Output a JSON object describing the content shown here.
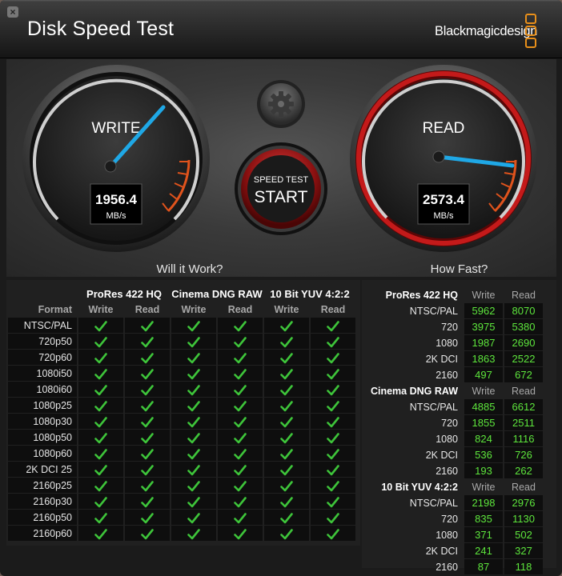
{
  "window": {
    "title": "Disk Speed Test",
    "brand": "Blackmagicdesign",
    "close_glyph": "×"
  },
  "gauges": {
    "write": {
      "label": "WRITE",
      "value": "1956.4",
      "unit": "MB/s"
    },
    "read": {
      "label": "READ",
      "value": "2573.4",
      "unit": "MB/s"
    }
  },
  "start_button": {
    "line1": "SPEED TEST",
    "line2": "START"
  },
  "settings_icon": "gear-icon",
  "will_it_work": {
    "title": "Will it Work?",
    "format_header": "Format",
    "groups": [
      "ProRes 422 HQ",
      "Cinema DNG RAW",
      "10 Bit YUV 4:2:2"
    ],
    "write_label": "Write",
    "read_label": "Read",
    "formats": [
      "NTSC/PAL",
      "720p50",
      "720p60",
      "1080i50",
      "1080i60",
      "1080p25",
      "1080p30",
      "1080p50",
      "1080p60",
      "2K DCI 25",
      "2160p25",
      "2160p30",
      "2160p50",
      "2160p60"
    ]
  },
  "how_fast": {
    "title": "How Fast?",
    "write_label": "Write",
    "read_label": "Read",
    "groups": [
      {
        "name": "ProRes 422 HQ",
        "rows": [
          {
            "format": "NTSC/PAL",
            "write": "5962",
            "read": "8070"
          },
          {
            "format": "720",
            "write": "3975",
            "read": "5380"
          },
          {
            "format": "1080",
            "write": "1987",
            "read": "2690"
          },
          {
            "format": "2K DCI",
            "write": "1863",
            "read": "2522"
          },
          {
            "format": "2160",
            "write": "497",
            "read": "672"
          }
        ]
      },
      {
        "name": "Cinema DNG RAW",
        "rows": [
          {
            "format": "NTSC/PAL",
            "write": "4885",
            "read": "6612"
          },
          {
            "format": "720",
            "write": "1855",
            "read": "2511"
          },
          {
            "format": "1080",
            "write": "824",
            "read": "1116"
          },
          {
            "format": "2K DCI",
            "write": "536",
            "read": "726"
          },
          {
            "format": "2160",
            "write": "193",
            "read": "262"
          }
        ]
      },
      {
        "name": "10 Bit YUV 4:2:2",
        "rows": [
          {
            "format": "NTSC/PAL",
            "write": "2198",
            "read": "2976"
          },
          {
            "format": "720",
            "write": "835",
            "read": "1130"
          },
          {
            "format": "1080",
            "write": "371",
            "read": "502"
          },
          {
            "format": "2K DCI",
            "write": "241",
            "read": "327"
          },
          {
            "format": "2160",
            "write": "87",
            "read": "118"
          }
        ]
      }
    ]
  },
  "colors": {
    "accent": "#e88f1a",
    "needle": "#1fa8e6",
    "value_green": "#5de53c",
    "check_green": "#3ec43a",
    "read_ring": "#b01818"
  }
}
